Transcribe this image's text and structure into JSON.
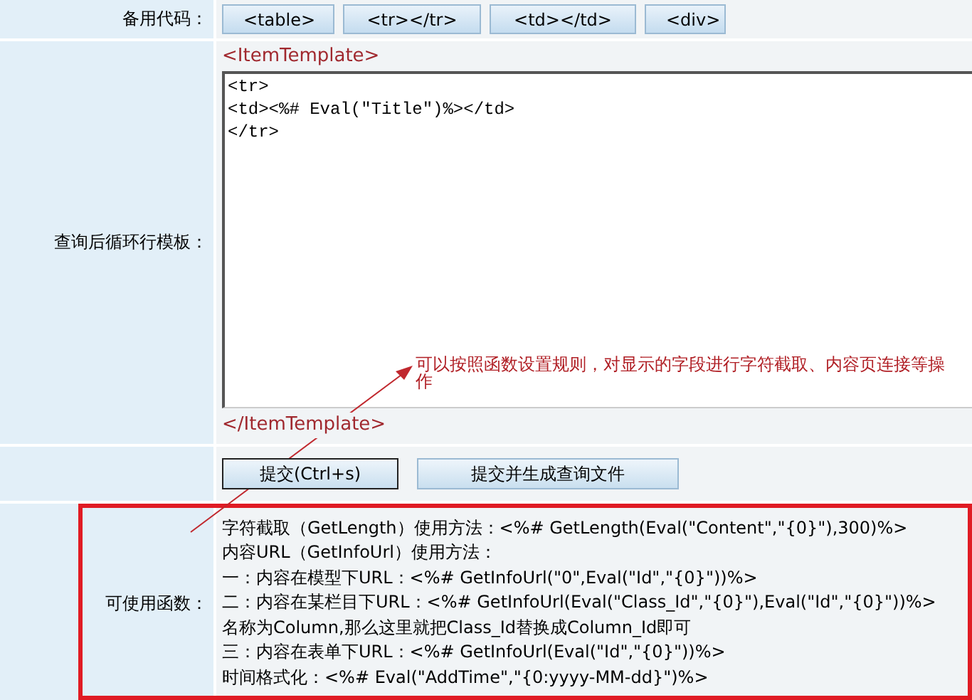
{
  "snippet_row": {
    "label": "备用代码：",
    "buttons": [
      "<table>",
      "<tr></tr>",
      "<td></td>",
      "<div>"
    ]
  },
  "template_row": {
    "label": "查询后循环行模板：",
    "open_tag": "<ItemTemplate>",
    "code_lines": [
      "<tr>",
      "<td><%# Eval(\"Title\")%></td>",
      "</tr>"
    ],
    "close_tag": "</ItemTemplate>"
  },
  "actions": [
    "提交(Ctrl+s)",
    "提交并生成查询文件"
  ],
  "functions_row": {
    "label": "可使用函数：",
    "lines": [
      "字符截取（GetLength）使用方法：<%# GetLength(Eval(\"Content\",\"{0}\"),300)%>",
      "内容URL（GetInfoUrl）使用方法：",
      "一：内容在模型下URL：<%# GetInfoUrl(\"0\",Eval(\"Id\",\"{0}\"))%>",
      "二：内容在某栏目下URL：<%# GetInfoUrl(Eval(\"Class_Id\",\"{0}\"),Eval(\"Id\",\"{0}\"))%>",
      "名称为Column,那么这里就把Class_Id替换成Column_Id即可",
      "三：内容在表单下URL：<%# GetInfoUrl(Eval(\"Id\",\"{0}\"))%>",
      "时间格式化：<%# Eval(\"AddTime\",\"{0:yyyy-MM-dd}\")%>"
    ]
  },
  "annotation": "可以按照函数设置规则，对显示的字段进行字符截取、内容页连接等操作"
}
